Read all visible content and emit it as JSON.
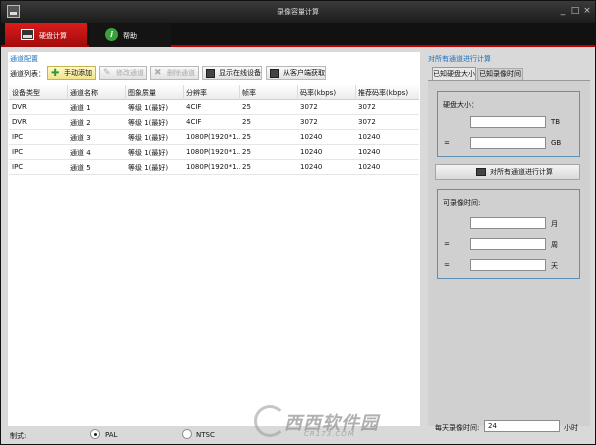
{
  "window": {
    "title": "录像容量计算",
    "controls": [
      "_",
      "□",
      "×"
    ]
  },
  "toolbar": {
    "tabs": [
      {
        "label": "硬盘计算",
        "icon": "disk-icon",
        "active": true
      },
      {
        "label": "帮助",
        "icon": "help-icon",
        "active": false
      }
    ]
  },
  "channel_config": {
    "section_title": "通道配置",
    "list_label": "通道列表：",
    "buttons": {
      "add": "手动添加",
      "edit": "修改通道",
      "delete": "删除通道",
      "show_online": "显示在线设备",
      "get_from_client": "从客户端获取"
    },
    "columns": [
      "设备类型",
      "通道名称",
      "图象质量",
      "分辨率",
      "帧率",
      "码率(kbps)",
      "推荐码率(kbps)"
    ],
    "rows": [
      [
        "DVR",
        "通道 1",
        "等级 1(最好)",
        "4CIF",
        "25",
        "3072",
        "3072"
      ],
      [
        "DVR",
        "通道 2",
        "等级 1(最好)",
        "4CIF",
        "25",
        "3072",
        "3072"
      ],
      [
        "IPC",
        "通道 3",
        "等级 1(最好)",
        "1080P(1920*1...",
        "25",
        "10240",
        "10240"
      ],
      [
        "IPC",
        "通道 4",
        "等级 1(最好)",
        "1080P(1920*1...",
        "25",
        "10240",
        "10240"
      ],
      [
        "IPC",
        "通道 5",
        "等级 1(最好)",
        "1080P(1920*1...",
        "25",
        "10240",
        "10240"
      ]
    ]
  },
  "standard": {
    "label": "制式:",
    "options": [
      {
        "label": "PAL",
        "selected": true
      },
      {
        "label": "NTSC",
        "selected": false
      }
    ]
  },
  "calc_panel": {
    "title": "对所有通道进行计算",
    "tabs": [
      "已知硬盘大小",
      "已知录像时间"
    ],
    "disk_size": {
      "label": "硬盘大小：",
      "eq": "=",
      "tb_unit": "TB",
      "gb_unit": "GB",
      "tb_value": "",
      "gb_value": ""
    },
    "calc_button": "对所有通道进行计算",
    "record_time": {
      "label": "可录像时间:",
      "eq": "=",
      "month_unit": "月",
      "week_unit": "周",
      "day_unit": "天"
    },
    "daily": {
      "label": "每天录像时间:",
      "value": "24",
      "unit": "小时"
    }
  },
  "watermark": {
    "text": "西西软件园",
    "sub": "CR173.COM"
  },
  "colors": {
    "accent_red": "#c00000",
    "section_blue": "#1d6fb8",
    "box_border": "#5d8fb3"
  }
}
